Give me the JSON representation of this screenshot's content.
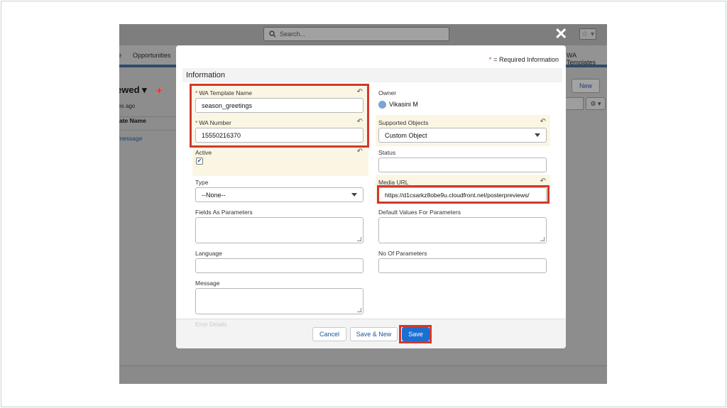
{
  "background_app": {
    "search_placeholder": "Search...",
    "nav_items": [
      "e",
      "Opportunities",
      "WA Templates"
    ],
    "list_title": "ewed ▾",
    "list_subtitle": "tes ago",
    "column_header": "ate Name",
    "rows": [
      "message",
      "l"
    ],
    "new_button": "New",
    "gear_label": "⚙ ▾",
    "pin_icon": "pin-icon",
    "close_icon": "close-icon"
  },
  "modal": {
    "required_info": "= Required Information",
    "required_star": "*",
    "section_title": "Information",
    "fields": {
      "wa_template_name": {
        "label": "WA Template Name",
        "value": "season_greetings",
        "required": true
      },
      "owner": {
        "label": "Owner",
        "value": "Vikasini M"
      },
      "wa_number": {
        "label": "WA Number",
        "value": "15550216370",
        "required": true
      },
      "supported_objects": {
        "label": "Supported Objects",
        "value": "Custom Object"
      },
      "active": {
        "label": "Active",
        "checked": true,
        "check_glyph": "✔"
      },
      "status": {
        "label": "Status",
        "value": ""
      },
      "type": {
        "label": "Type",
        "value": "--None--"
      },
      "media_url": {
        "label": "Media URL",
        "value": "https://d1csarkz8obe9u.cloudfront.net/posterpreviews/"
      },
      "fields_as_parameters": {
        "label": "Fields As Parameters",
        "value": ""
      },
      "default_values": {
        "label": "Default Values For Parameters",
        "value": ""
      },
      "language": {
        "label": "Language",
        "value": ""
      },
      "no_of_parameters": {
        "label": "No Of Parameters",
        "value": ""
      },
      "message": {
        "label": "Message",
        "value": ""
      },
      "error_details": {
        "label": "Error Details"
      }
    },
    "buttons": {
      "cancel": "Cancel",
      "save_new": "Save & New",
      "save": "Save"
    },
    "undo_glyph": "↶"
  },
  "colors": {
    "highlight_box": "#d2382d",
    "primary_button": "#1b6fd1",
    "edited_field_bg": "#fbf6e4"
  }
}
